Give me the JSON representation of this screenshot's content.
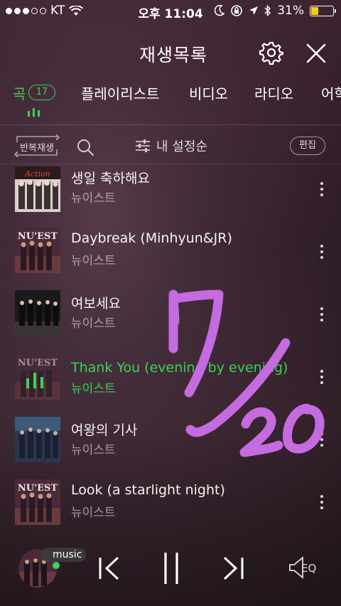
{
  "status": {
    "carrier": "KT",
    "time": "오후 11:04",
    "battery": "31%",
    "battery_level": 0.31
  },
  "header": {
    "title": "재생목록",
    "settings_icon": "gear-icon",
    "close_icon": "close-icon"
  },
  "tabs": [
    {
      "label": "곡",
      "count": "17",
      "active": true
    },
    {
      "label": "플레이리스트"
    },
    {
      "label": "비디오"
    },
    {
      "label": "라디오"
    },
    {
      "label": "어학"
    }
  ],
  "toolbar": {
    "repeat_label": "반복재생",
    "sort_label": "내 설정순",
    "edit_label": "편집"
  },
  "songs": [
    {
      "title": "생일 축하해요",
      "artist": "뉴이스트",
      "playing": false
    },
    {
      "title": "Daybreak (Minhyun&JR)",
      "artist": "뉴이스트",
      "playing": false
    },
    {
      "title": "여보세요",
      "artist": "뉴이스트",
      "playing": false
    },
    {
      "title": "Thank You (evening by evening)",
      "artist": "뉴이스트",
      "playing": true
    },
    {
      "title": "여왕의 기사",
      "artist": "뉴이스트",
      "playing": false
    },
    {
      "title": "Look (a starlight night)",
      "artist": "뉴이스트",
      "playing": false
    }
  ],
  "player": {
    "source_tag": "music",
    "eq_label": "EQ"
  },
  "overlay": {
    "handwriting": "7/20",
    "color": "#c56be0"
  },
  "colors": {
    "accent": "#3bd35a"
  }
}
